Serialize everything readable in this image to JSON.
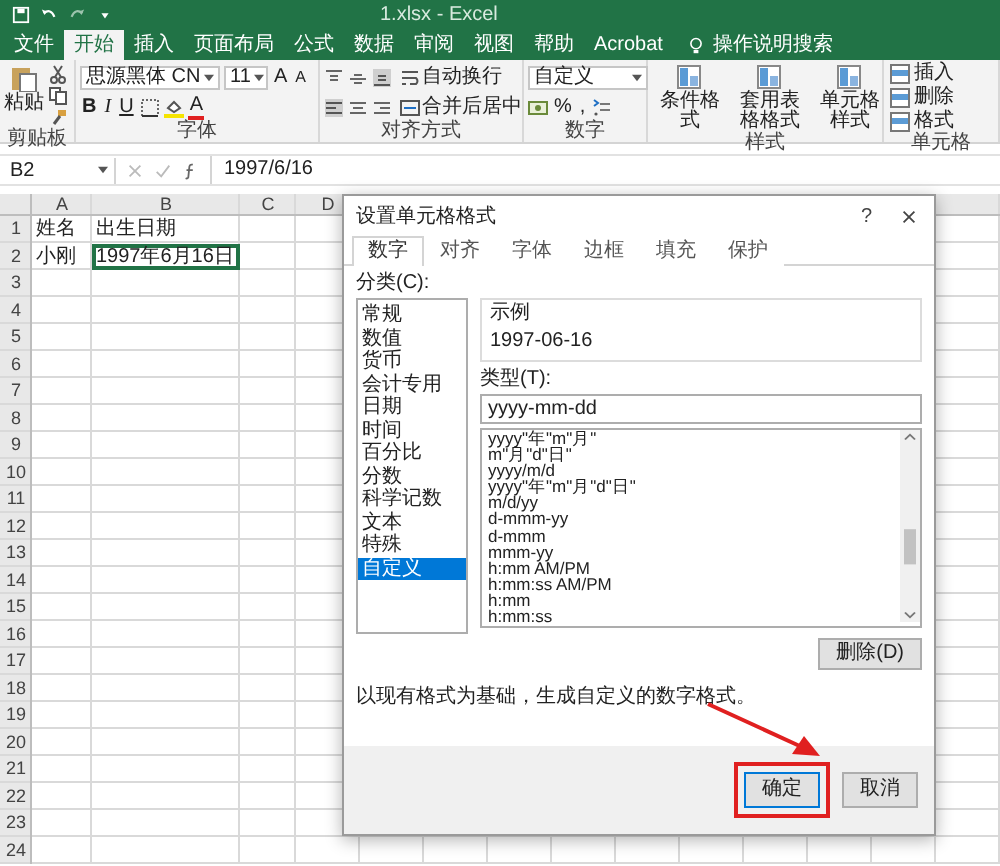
{
  "window": {
    "title": "1.xlsx - Excel"
  },
  "ribbon_tabs": [
    {
      "label": "文件",
      "selected": false
    },
    {
      "label": "开始",
      "selected": true
    },
    {
      "label": "插入",
      "selected": false
    },
    {
      "label": "页面布局",
      "selected": false
    },
    {
      "label": "公式",
      "selected": false
    },
    {
      "label": "数据",
      "selected": false
    },
    {
      "label": "审阅",
      "selected": false
    },
    {
      "label": "视图",
      "selected": false
    },
    {
      "label": "帮助",
      "selected": false
    },
    {
      "label": "Acrobat",
      "selected": false
    }
  ],
  "tell_me": "操作说明搜索",
  "ribbon": {
    "clipboard": {
      "paste": "粘贴",
      "label": "剪贴板"
    },
    "font": {
      "font_name": "思源黑体 CN",
      "font_size": "11",
      "size_buttons": [
        "A",
        "A"
      ],
      "style_buttons": [
        "B",
        "I",
        "U"
      ],
      "font_color": "A",
      "label": "字体"
    },
    "alignment": {
      "wrap": "自动换行",
      "merge": "合并后居中",
      "label": "对齐方式"
    },
    "number": {
      "format": "自定义",
      "symbols": [
        "%",
        ","
      ],
      "label": "数字"
    },
    "styles": {
      "buttons": [
        "条件格式",
        "套用表格格式",
        "单元格样式"
      ],
      "label": "样式"
    },
    "cells": {
      "buttons": [
        "插入",
        "删除",
        "格式"
      ],
      "label": "单元格"
    }
  },
  "formula_bar": {
    "name_box": "B2",
    "formula": "1997/6/16"
  },
  "sheet": {
    "columns": [
      "A",
      "B",
      "C",
      "D"
    ],
    "rows": [
      {
        "number": "1",
        "cells": [
          {
            "text": "姓名",
            "selected": false
          },
          {
            "text": "出生日期",
            "selected": false
          }
        ]
      },
      {
        "number": "2",
        "cells": [
          {
            "text": "小刚",
            "selected": false
          },
          {
            "text": "1997年6月16日",
            "selected": true
          }
        ]
      },
      {
        "number": "3"
      },
      {
        "number": "4"
      },
      {
        "number": "5"
      },
      {
        "number": "6"
      },
      {
        "number": "7"
      },
      {
        "number": "8"
      },
      {
        "number": "9"
      },
      {
        "number": "10"
      },
      {
        "number": "11"
      },
      {
        "number": "12"
      },
      {
        "number": "13"
      },
      {
        "number": "14"
      },
      {
        "number": "15"
      },
      {
        "number": "16"
      },
      {
        "number": "17"
      },
      {
        "number": "18"
      },
      {
        "number": "19"
      },
      {
        "number": "20"
      },
      {
        "number": "21"
      },
      {
        "number": "22"
      },
      {
        "number": "23"
      },
      {
        "number": "24"
      }
    ]
  },
  "dialog": {
    "title": "设置单元格格式",
    "help": "?",
    "tabs": [
      {
        "label": "数字",
        "selected": true
      },
      {
        "label": "对齐",
        "selected": false
      },
      {
        "label": "字体",
        "selected": false
      },
      {
        "label": "边框",
        "selected": false
      },
      {
        "label": "填充",
        "selected": false
      },
      {
        "label": "保护",
        "selected": false
      }
    ],
    "category_label": "分类(C):",
    "categories": [
      {
        "label": "常规",
        "selected": false
      },
      {
        "label": "数值",
        "selected": false
      },
      {
        "label": "货币",
        "selected": false
      },
      {
        "label": "会计专用",
        "selected": false
      },
      {
        "label": "日期",
        "selected": false
      },
      {
        "label": "时间",
        "selected": false
      },
      {
        "label": "百分比",
        "selected": false
      },
      {
        "label": "分数",
        "selected": false
      },
      {
        "label": "科学记数",
        "selected": false
      },
      {
        "label": "文本",
        "selected": false
      },
      {
        "label": "特殊",
        "selected": false
      },
      {
        "label": "自定义",
        "selected": true
      }
    ],
    "sample_label": "示例",
    "sample": "1997-06-16",
    "type_label": "类型(T):",
    "type_value": "yyyy-mm-dd",
    "types": [
      "yyyy\"年\"m\"月\"",
      "m\"月\"d\"日\"",
      "yyyy/m/d",
      "yyyy\"年\"m\"月\"d\"日\"",
      "m/d/yy",
      "d-mmm-yy",
      "d-mmm",
      "mmm-yy",
      "h:mm AM/PM",
      "h:mm:ss AM/PM",
      "h:mm",
      "h:mm:ss"
    ],
    "delete_button": "删除(D)",
    "note": "以现有格式为基础，生成自定义的数字格式。",
    "buttons": [
      {
        "label": "确定",
        "kind": "primary"
      },
      {
        "label": "取消",
        "kind": "normal"
      }
    ]
  }
}
